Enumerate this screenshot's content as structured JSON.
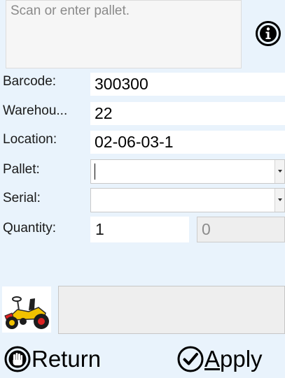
{
  "scan": {
    "placeholder": "Scan or enter pallet."
  },
  "form": {
    "barcode_label": "Barcode:",
    "barcode_value": "300300",
    "warehouse_label": "Warehou...",
    "warehouse_value": "22",
    "location_label": "Location:",
    "location_value": "02-06-03-1",
    "pallet_label": "Pallet:",
    "pallet_value": "",
    "serial_label": "Serial:",
    "serial_value": "",
    "quantity_label": "Quantity:",
    "quantity_value": "1",
    "quantity_secondary": "0"
  },
  "buttons": {
    "return_label": "Return",
    "apply_first_letter": "A",
    "apply_rest": "pply"
  },
  "icons": {
    "info": "info-icon",
    "return": "stop-hand-icon",
    "apply": "checkmark-circle-icon",
    "product": "go-kart-image"
  },
  "colors": {
    "background": "#e9f3fc",
    "scan_box": "#f6f6f6",
    "disabled_field": "#eeeeee"
  }
}
